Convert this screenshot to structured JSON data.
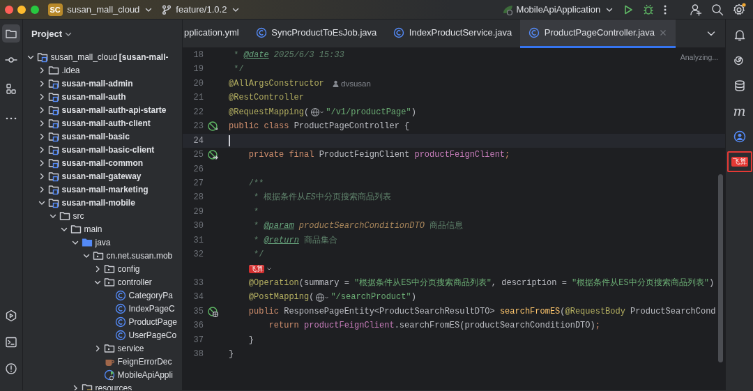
{
  "title_bar": {
    "project_badge": "SC",
    "project": "susan_mall_cloud",
    "branch": "feature/1.0.2",
    "run_config": "MobileApiApplication",
    "settings_notice": true
  },
  "left_toolbar": [
    {
      "kind": "project",
      "selected": true
    },
    {
      "kind": "commit",
      "selected": false
    },
    {
      "kind": "structure",
      "selected": false
    },
    {
      "kind": "more",
      "selected": false
    },
    {
      "kind": "services",
      "selected": false
    },
    {
      "kind": "terminal",
      "selected": false
    },
    {
      "kind": "problems",
      "selected": false
    }
  ],
  "project_panel": {
    "title": "Project",
    "tree": [
      {
        "kind": "project",
        "name": "susan_mall_cloud",
        "note": "[susan-mall-",
        "expanded": true,
        "children": [
          {
            "kind": "folder",
            "name": ".idea",
            "expanded": false
          },
          {
            "kind": "module",
            "name": "susan-mall-admin",
            "expanded": false
          },
          {
            "kind": "module",
            "name": "susan-mall-auth",
            "expanded": false
          },
          {
            "kind": "module",
            "name": "susan-mall-auth-api-starte",
            "expanded": false
          },
          {
            "kind": "module",
            "name": "susan-mall-auth-client",
            "expanded": false
          },
          {
            "kind": "module",
            "name": "susan-mall-basic",
            "expanded": false
          },
          {
            "kind": "module",
            "name": "susan-mall-basic-client",
            "expanded": false
          },
          {
            "kind": "module",
            "name": "susan-mall-common",
            "expanded": false
          },
          {
            "kind": "module",
            "name": "susan-mall-gateway",
            "expanded": false
          },
          {
            "kind": "module",
            "name": "susan-mall-marketing",
            "expanded": false
          },
          {
            "kind": "module",
            "name": "susan-mall-mobile",
            "expanded": true,
            "children": [
              {
                "kind": "folder",
                "name": "src",
                "expanded": true,
                "children": [
                  {
                    "kind": "folder",
                    "name": "main",
                    "expanded": true,
                    "children": [
                      {
                        "kind": "source",
                        "name": "java",
                        "expanded": true,
                        "children": [
                          {
                            "kind": "package",
                            "name": "cn.net.susan.mob",
                            "expanded": true,
                            "children": [
                              {
                                "kind": "package",
                                "name": "config",
                                "expanded": false
                              },
                              {
                                "kind": "package",
                                "name": "controller",
                                "expanded": true,
                                "children": [
                                  {
                                    "kind": "class",
                                    "name": "CategoryPa"
                                  },
                                  {
                                    "kind": "class",
                                    "name": "IndexPageC"
                                  },
                                  {
                                    "kind": "class",
                                    "name": "ProductPage"
                                  },
                                  {
                                    "kind": "class",
                                    "name": "UserPageCo"
                                  }
                                ]
                              },
                              {
                                "kind": "package",
                                "name": "service",
                                "expanded": false
                              },
                              {
                                "kind": "java-file",
                                "name": "FeignErrorDec"
                              },
                              {
                                "kind": "app-class",
                                "name": "MobileApiAppli"
                              }
                            ]
                          }
                        ]
                      },
                      {
                        "kind": "resources",
                        "name": "resources",
                        "expanded": false
                      }
                    ]
                  }
                ]
              }
            ]
          }
        ]
      }
    ]
  },
  "editor_tabs": [
    {
      "kind": "yaml",
      "label": "pplication.yml",
      "selected": false
    },
    {
      "kind": "class",
      "label": "SyncProductToEsJob.java",
      "selected": false
    },
    {
      "kind": "class",
      "label": "IndexProductService.java",
      "selected": false
    },
    {
      "kind": "class",
      "label": "ProductPageController.java",
      "selected": true
    }
  ],
  "editor": {
    "status": "Analyzing...",
    "lines": [
      {
        "number": "18",
        "current": false,
        "tokens": [
          {
            "kind": "comment",
            "text": " * "
          },
          {
            "kind": "doctag",
            "text": "@date"
          },
          {
            "kind": "doc-value",
            "text": " 2025/6/3 15:33"
          }
        ]
      },
      {
        "number": "19",
        "current": false,
        "tokens": [
          {
            "kind": "comment",
            "text": " */"
          }
        ]
      },
      {
        "number": "20",
        "current": false,
        "tokens": [
          {
            "kind": "annotation",
            "text": "@AllArgsConstructor"
          },
          {
            "kind": "author",
            "text": "dvsusan"
          }
        ]
      },
      {
        "number": "21",
        "current": false,
        "tokens": [
          {
            "kind": "annotation",
            "text": "@RestController"
          }
        ]
      },
      {
        "number": "22",
        "current": false,
        "tokens": [
          {
            "kind": "annotation",
            "text": "@RequestMapping"
          },
          {
            "kind": "plain",
            "text": "("
          },
          {
            "kind": "url-inlay"
          },
          {
            "kind": "string",
            "text": "\"/v1/productPage\""
          },
          {
            "kind": "plain",
            "text": ")"
          }
        ]
      },
      {
        "number": "23",
        "current": false,
        "gutter": {
          "kind": "bean"
        },
        "tokens": [
          {
            "kind": "keyword",
            "text": "public class "
          },
          {
            "kind": "plain",
            "text": "ProductPageController {"
          }
        ]
      },
      {
        "number": "24",
        "current": true
      },
      {
        "number": "25",
        "current": false,
        "gutter": {
          "kind": "inject"
        },
        "tokens": [
          {
            "kind": "keyword",
            "text": "    private final "
          },
          {
            "kind": "plain",
            "text": "ProductFeignClient "
          },
          {
            "kind": "field",
            "text": "productFeignClient"
          },
          {
            "kind": "keyword",
            "text": ";"
          }
        ]
      },
      {
        "number": "26",
        "current": false
      },
      {
        "number": "27",
        "current": false,
        "tokens": [
          {
            "kind": "comment",
            "text": "    /**"
          }
        ]
      },
      {
        "number": "28",
        "current": false,
        "tokens": [
          {
            "kind": "comment",
            "text": "     * 根据条件从"
          },
          {
            "kind": "doc-value",
            "text": "ES"
          },
          {
            "kind": "comment",
            "text": "中分页搜索商品列表"
          }
        ]
      },
      {
        "number": "29",
        "current": false,
        "tokens": [
          {
            "kind": "comment",
            "text": "     *"
          }
        ]
      },
      {
        "number": "30",
        "current": false,
        "tokens": [
          {
            "kind": "comment",
            "text": "     * "
          },
          {
            "kind": "doctag",
            "text": "@param"
          },
          {
            "kind": "param",
            "text": " productSearchConditionDTO"
          },
          {
            "kind": "comment",
            "text": " 商品信息"
          }
        ]
      },
      {
        "number": "31",
        "current": false,
        "tokens": [
          {
            "kind": "comment",
            "text": "     * "
          },
          {
            "kind": "doctag",
            "text": "@return"
          },
          {
            "kind": "comment",
            "text": " 商品集合"
          }
        ]
      },
      {
        "number": "32",
        "current": false,
        "tokens": [
          {
            "kind": "comment",
            "text": "     */"
          }
        ]
      },
      {
        "current": false,
        "tokens": [
          {
            "kind": "plugin-inlay",
            "text": "飞算"
          }
        ]
      },
      {
        "number": "33",
        "current": false,
        "tokens": [
          {
            "kind": "annotation",
            "text": "    @Operation"
          },
          {
            "kind": "plain",
            "text": "(summary = "
          },
          {
            "kind": "string",
            "text": "\"根据条件从ES中分页搜索商品列表\""
          },
          {
            "kind": "plain",
            "text": ", description = "
          },
          {
            "kind": "string",
            "text": "\"根据条件从ES中分页搜索商品列表\""
          },
          {
            "kind": "plain",
            "text": ")"
          }
        ]
      },
      {
        "number": "34",
        "current": false,
        "tokens": [
          {
            "kind": "annotation",
            "text": "    @PostMapping"
          },
          {
            "kind": "plain",
            "text": "("
          },
          {
            "kind": "url-inlay"
          },
          {
            "kind": "string",
            "text": "\"/searchProduct\""
          },
          {
            "kind": "plain",
            "text": ")"
          }
        ]
      },
      {
        "number": "35",
        "current": false,
        "gutter": {
          "kind": "web"
        },
        "tokens": [
          {
            "kind": "keyword",
            "text": "    public "
          },
          {
            "kind": "plain",
            "text": "ResponsePageEntity<ProductSearchResultDTO> "
          },
          {
            "kind": "method",
            "text": "searchFromES"
          },
          {
            "kind": "plain",
            "text": "("
          },
          {
            "kind": "annotation",
            "text": "@RequestBody"
          },
          {
            "kind": "plain",
            "text": " ProductSearchCond"
          }
        ]
      },
      {
        "number": "36",
        "current": false,
        "tokens": [
          {
            "kind": "keyword",
            "text": "        return "
          },
          {
            "kind": "field",
            "text": "productFeignClient"
          },
          {
            "kind": "plain",
            "text": ".searchFromES(productSearchConditionDTO)"
          },
          {
            "kind": "keyword",
            "text": ";"
          }
        ]
      },
      {
        "number": "37",
        "current": false,
        "tokens": [
          {
            "kind": "plain",
            "text": "    }"
          }
        ]
      },
      {
        "number": "38",
        "current": false,
        "tokens": [
          {
            "kind": "plain",
            "text": "}"
          }
        ]
      }
    ]
  },
  "right_toolbar": [
    {
      "kind": "notifications",
      "highlighted": false
    },
    {
      "kind": "ai",
      "highlighted": false
    },
    {
      "kind": "database",
      "highlighted": false
    },
    {
      "kind": "maven",
      "text": "m",
      "highlighted": false
    },
    {
      "kind": "account",
      "highlighted": false
    },
    {
      "kind": "plugin",
      "text": "飞算",
      "highlighted": true
    }
  ]
}
